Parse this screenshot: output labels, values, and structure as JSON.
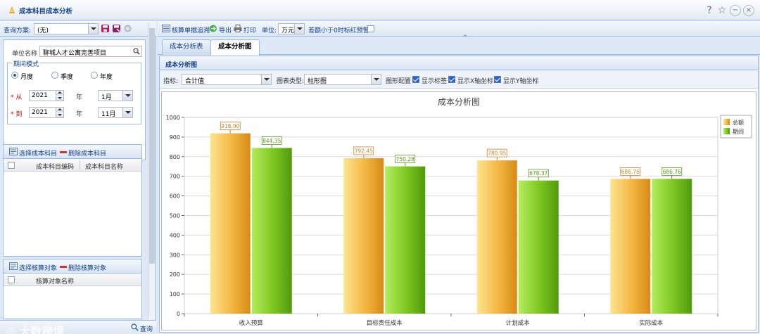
{
  "window": {
    "title": "成本科目成本分析",
    "buttons": [
      "?",
      "☆",
      "−",
      "×"
    ]
  },
  "left": {
    "query_scheme_label": "查询方案:",
    "query_scheme_value": "(无)",
    "unit_name_label": "单位名称",
    "unit_name_value": "聊城人才公寓完善项目",
    "period_mode_label": "期间模式",
    "period_options": [
      "月度",
      "季度",
      "年度"
    ],
    "period_selected": "月度",
    "from_label": "* 从",
    "from_year": "2021",
    "from_month": "1月",
    "to_label": "* 到",
    "to_year": "2021",
    "to_month": "11月",
    "year_label": "年",
    "cost_subject": {
      "select_label": "选择成本科目",
      "delete_label": "删除成本科目",
      "columns": [
        "成本科目编码",
        "成本科目名称"
      ]
    },
    "accounting_object": {
      "select_label": "选择核算对象",
      "delete_label": "删除核算对象",
      "columns": [
        "核算对象名称"
      ]
    },
    "query_button": "查询"
  },
  "toolbar": {
    "trace_label": "核算单据追溯",
    "export_label": "导出",
    "print_label": "打印",
    "unit_label": "单位:",
    "unit_value": "万元",
    "warn_label": "差额小于0时标红预警"
  },
  "tabs": [
    {
      "label": "成本分析表",
      "active": false
    },
    {
      "label": "成本分析图",
      "active": true
    }
  ],
  "analysis": {
    "panel_title": "成本分析图",
    "indicator_label": "指标:",
    "indicator_value": "合计值",
    "chart_type_label": "图表类型:",
    "chart_type_value": "柱形图",
    "config_label": "图形配置",
    "checks": [
      {
        "label": "显示标签",
        "checked": true
      },
      {
        "label": "显示X轴坐标",
        "checked": true
      },
      {
        "label": "显示Y轴坐标",
        "checked": true
      }
    ]
  },
  "chart_data": {
    "type": "bar",
    "title": "成本分析图",
    "categories": [
      "收入预算",
      "目标责任成本",
      "计划成本",
      "实际成本"
    ],
    "series": [
      {
        "name": "总额",
        "values": [
          918.9,
          792.45,
          780.95,
          686.76
        ],
        "color": "#f0b43c"
      },
      {
        "name": "期间",
        "values": [
          844.35,
          750.28,
          678.37,
          686.76
        ],
        "color": "#7cc520"
      }
    ],
    "ylim": [
      0,
      1000
    ],
    "yticks": [
      0,
      100,
      200,
      300,
      400,
      500,
      600,
      700,
      800,
      900,
      1000
    ],
    "legend_position": "top-right",
    "grid": true
  },
  "watermark": "大数跨境"
}
